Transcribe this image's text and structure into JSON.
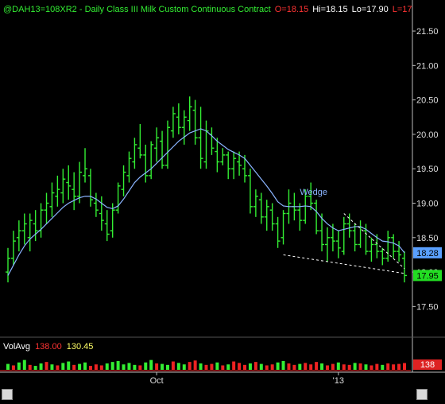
{
  "header": {
    "symbol": "@DAH13=108XR2 - Daily  Class III Milk Custom Continuous Contract",
    "open": "O=18.15",
    "high": "Hi=18.15",
    "low": "Lo=17.90",
    "last": "L=17"
  },
  "volume_legend": {
    "label": "VolAvg",
    "vol": "138.00",
    "avg": "130.45",
    "axis_badge": "138"
  },
  "annotations": {
    "pattern_label": "Wedge"
  },
  "price_badges": {
    "ma_value": "18.28",
    "last_value": "17.95"
  },
  "colors": {
    "background": "#000000",
    "up_bar": "#33ee33",
    "down_bar": "#33ee33",
    "moving_average": "#8ab4ff",
    "wedge_lines": "#ffffff",
    "axis": "#bbbbbb",
    "header_text": "#33ee33",
    "open_text": "#ff3333",
    "ma_badge": "#5aa0ff",
    "last_badge": "#22dd22",
    "volume_up": "#33ee33",
    "volume_down": "#ee2222"
  },
  "chart_data": {
    "type": "line",
    "subtype": "ohlc-bar",
    "title": "@DAH13=108XR2 - Daily  Class III Milk Custom Continuous Contract",
    "xlabel": "",
    "ylabel": "",
    "x_ticks": [
      "Oct",
      "'13"
    ],
    "y_ticks": [
      "17.50",
      "18.00",
      "18.50",
      "19.00",
      "19.50",
      "20.00",
      "20.50",
      "21.00",
      "21.50"
    ],
    "ylim": [
      17.1,
      21.72
    ],
    "grid": false,
    "ohlc": [
      [
        18.0,
        18.35,
        17.85,
        18.2
      ],
      [
        18.2,
        18.6,
        18.1,
        18.45
      ],
      [
        18.5,
        18.75,
        18.3,
        18.6
      ],
      [
        18.6,
        18.85,
        18.4,
        18.7
      ],
      [
        18.5,
        18.85,
        18.3,
        18.75
      ],
      [
        18.7,
        18.9,
        18.45,
        18.6
      ],
      [
        18.6,
        19.0,
        18.5,
        18.9
      ],
      [
        18.9,
        19.15,
        18.7,
        19.0
      ],
      [
        18.95,
        19.3,
        18.8,
        19.15
      ],
      [
        19.1,
        19.4,
        18.95,
        19.2
      ],
      [
        19.15,
        19.5,
        19.0,
        19.35
      ],
      [
        19.3,
        19.55,
        19.05,
        19.25
      ],
      [
        19.2,
        19.45,
        18.9,
        19.1
      ],
      [
        19.1,
        19.6,
        19.0,
        19.45
      ],
      [
        19.4,
        19.8,
        19.3,
        19.5
      ],
      [
        19.4,
        19.5,
        18.95,
        19.05
      ],
      [
        19.0,
        19.15,
        18.8,
        18.9
      ],
      [
        18.85,
        19.1,
        18.6,
        18.75
      ],
      [
        18.7,
        18.9,
        18.45,
        18.55
      ],
      [
        18.6,
        19.0,
        18.5,
        18.9
      ],
      [
        18.9,
        19.3,
        18.85,
        19.25
      ],
      [
        19.2,
        19.55,
        19.1,
        19.45
      ],
      [
        19.4,
        19.75,
        19.3,
        19.65
      ],
      [
        19.6,
        19.95,
        19.5,
        19.85
      ],
      [
        19.8,
        20.15,
        19.65,
        19.7
      ],
      [
        19.7,
        19.85,
        19.3,
        19.4
      ],
      [
        19.4,
        19.9,
        19.35,
        19.85
      ],
      [
        19.8,
        20.1,
        19.6,
        19.95
      ],
      [
        19.9,
        20.05,
        19.5,
        19.55
      ],
      [
        19.55,
        20.2,
        19.5,
        20.1
      ],
      [
        20.05,
        20.4,
        19.95,
        20.3
      ],
      [
        20.25,
        20.45,
        20.0,
        20.1
      ],
      [
        20.1,
        20.35,
        19.85,
        20.25
      ],
      [
        20.2,
        20.55,
        20.05,
        20.4
      ],
      [
        20.35,
        20.5,
        19.85,
        19.95
      ],
      [
        19.95,
        20.4,
        19.5,
        19.65
      ],
      [
        19.6,
        20.2,
        19.5,
        20.05
      ],
      [
        20.0,
        20.1,
        19.7,
        19.8
      ],
      [
        19.75,
        19.95,
        19.45,
        19.6
      ],
      [
        19.6,
        19.8,
        19.55,
        19.7
      ],
      [
        19.7,
        19.75,
        19.35,
        19.5
      ],
      [
        19.5,
        19.75,
        19.35,
        19.65
      ],
      [
        19.6,
        19.75,
        19.4,
        19.55
      ],
      [
        19.5,
        19.7,
        19.3,
        19.4
      ],
      [
        19.4,
        19.5,
        18.85,
        18.95
      ],
      [
        18.95,
        19.2,
        18.8,
        19.1
      ],
      [
        19.05,
        19.15,
        18.7,
        18.8
      ],
      [
        18.8,
        19.05,
        18.6,
        18.95
      ],
      [
        18.9,
        19.0,
        18.6,
        18.7
      ],
      [
        18.7,
        18.8,
        18.35,
        18.45
      ],
      [
        18.5,
        18.9,
        18.4,
        18.85
      ],
      [
        18.85,
        19.2,
        18.7,
        19.0
      ],
      [
        18.95,
        19.15,
        18.75,
        18.9
      ],
      [
        18.9,
        19.0,
        18.6,
        18.75
      ],
      [
        18.75,
        19.2,
        18.7,
        19.1
      ],
      [
        19.1,
        19.3,
        18.9,
        19.0
      ],
      [
        19.0,
        19.05,
        18.55,
        18.6
      ],
      [
        18.6,
        18.85,
        18.3,
        18.4
      ],
      [
        18.4,
        18.65,
        18.15,
        18.5
      ],
      [
        18.5,
        18.7,
        18.3,
        18.45
      ],
      [
        18.45,
        18.6,
        18.2,
        18.35
      ],
      [
        18.3,
        18.8,
        18.25,
        18.7
      ],
      [
        18.7,
        18.85,
        18.5,
        18.6
      ],
      [
        18.6,
        18.7,
        18.3,
        18.4
      ],
      [
        18.4,
        18.75,
        18.35,
        18.65
      ],
      [
        18.6,
        18.7,
        18.25,
        18.3
      ],
      [
        18.3,
        18.5,
        18.15,
        18.4
      ],
      [
        18.4,
        18.55,
        18.2,
        18.3
      ],
      [
        18.3,
        18.35,
        18.1,
        18.2
      ],
      [
        18.2,
        18.6,
        18.15,
        18.5
      ],
      [
        18.5,
        18.55,
        18.2,
        18.3
      ],
      [
        18.3,
        18.45,
        18.15,
        18.25
      ],
      [
        18.2,
        18.3,
        17.85,
        17.95
      ]
    ],
    "series": [
      {
        "values": [
          17.95,
          18.1,
          18.25,
          18.38,
          18.48,
          18.55,
          18.62,
          18.7,
          18.78,
          18.86,
          18.94,
          19.0,
          19.04,
          19.08,
          19.1,
          19.1,
          19.06,
          19.0,
          18.94,
          18.92,
          18.96,
          19.06,
          19.18,
          19.3,
          19.38,
          19.44,
          19.5,
          19.58,
          19.66,
          19.74,
          19.82,
          19.9,
          19.96,
          20.02,
          20.05,
          20.08,
          20.05,
          19.98,
          19.9,
          19.84,
          19.78,
          19.74,
          19.7,
          19.65,
          19.55,
          19.45,
          19.35,
          19.25,
          19.14,
          19.02,
          18.96,
          18.95,
          18.95,
          18.95,
          18.96,
          18.95,
          18.88,
          18.78,
          18.7,
          18.64,
          18.6,
          18.62,
          18.64,
          18.66,
          18.66,
          18.62,
          18.56,
          18.5,
          18.45,
          18.44,
          18.42,
          18.38,
          18.28
        ]
      }
    ],
    "volume": {
      "ylim": [
        0,
        600
      ],
      "values": [
        120,
        90,
        150,
        200,
        100,
        80,
        130,
        160,
        110,
        90,
        140,
        170,
        100,
        120,
        150,
        80,
        110,
        90,
        130,
        160,
        180,
        110,
        140,
        100,
        90,
        150,
        200,
        130,
        120,
        100,
        170,
        140,
        110,
        160,
        190,
        130,
        100,
        120,
        150,
        90,
        110,
        170,
        140,
        100,
        130,
        160,
        120,
        90,
        110,
        150,
        180,
        130,
        100,
        120,
        140,
        110,
        160,
        130,
        90,
        120,
        150,
        110,
        100,
        140,
        130,
        110,
        90,
        120,
        100,
        130,
        110,
        120,
        138
      ],
      "direction": [
        "up",
        "down",
        "up",
        "up",
        "down",
        "up",
        "up",
        "down",
        "up",
        "down",
        "up",
        "up",
        "down",
        "up",
        "up",
        "down",
        "down",
        "down",
        "up",
        "up",
        "up",
        "up",
        "up",
        "up",
        "down",
        "up",
        "up",
        "down",
        "up",
        "up",
        "down",
        "up",
        "up",
        "down",
        "down",
        "up",
        "down",
        "down",
        "up",
        "down",
        "up",
        "down",
        "down",
        "down",
        "up",
        "down",
        "up",
        "down",
        "down",
        "up",
        "up",
        "down",
        "down",
        "up",
        "down",
        "down",
        "down",
        "up",
        "down",
        "down",
        "up",
        "down",
        "down",
        "up",
        "down",
        "up",
        "down",
        "down",
        "up",
        "down",
        "down",
        "down",
        "down"
      ]
    },
    "wedge": {
      "upper": [
        [
          61,
          18.85
        ],
        [
          72,
          18.05
        ]
      ],
      "lower": [
        [
          50,
          18.25
        ],
        [
          72,
          17.98
        ]
      ],
      "note_anchor": [
        53,
        19.12
      ]
    }
  }
}
